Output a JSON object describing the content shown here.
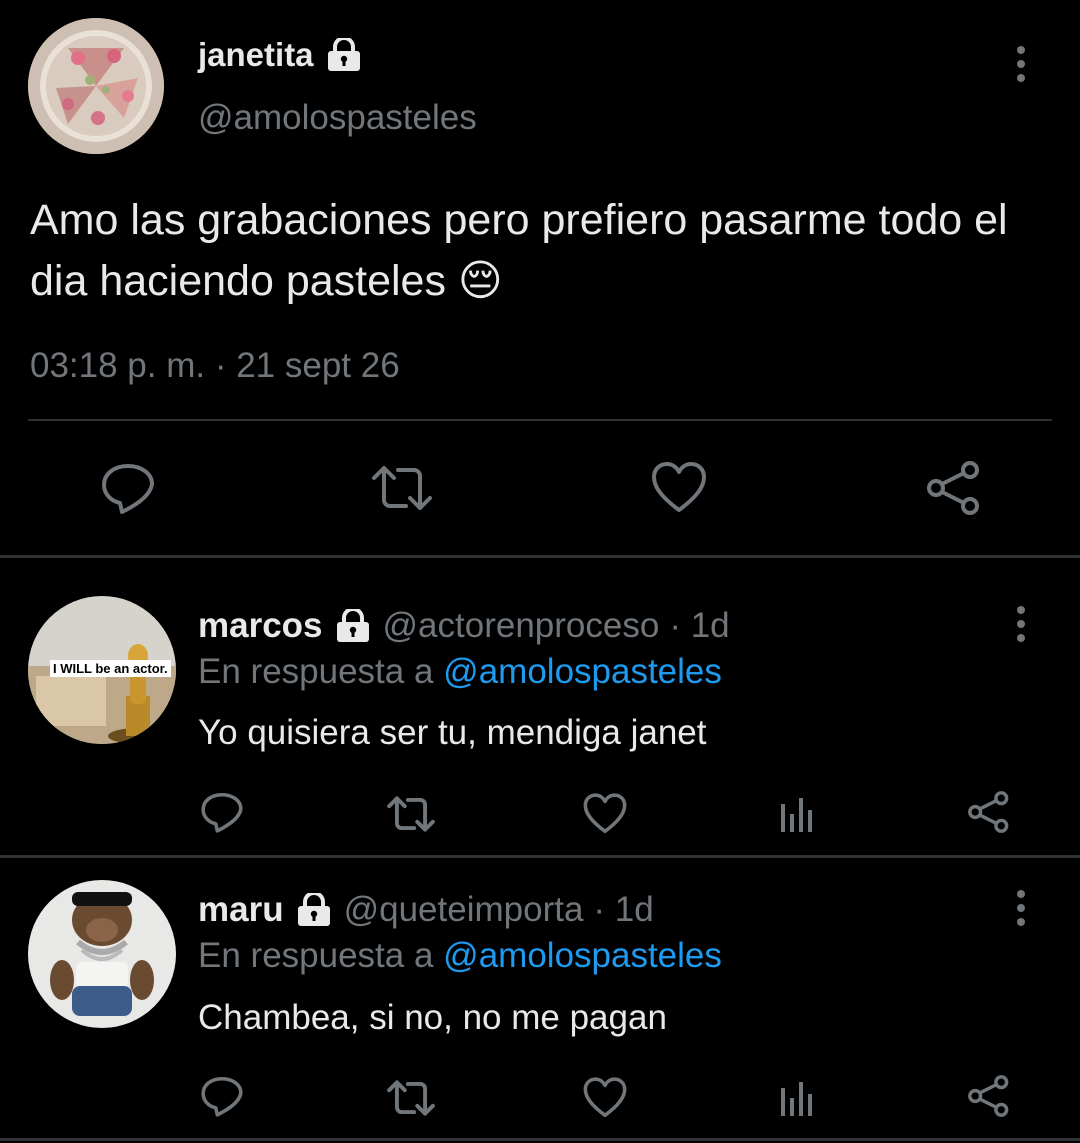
{
  "main_tweet": {
    "author_name": "janetita",
    "handle": "@amolospasteles",
    "text": "Amo las grabaciones pero prefiero pasarme todo el dia haciendo pasteles 😔",
    "timestamp": "03:18 p. m. · 21 sept 26",
    "avatar_icon": "cake-photo-avatar",
    "actions": [
      "reply-icon",
      "retweet-icon",
      "like-icon",
      "share-icon"
    ]
  },
  "replies": [
    {
      "author_name": "marcos",
      "handle": "@actorenproceso",
      "time": "· 1d",
      "reply_prefix": "En respuesta a",
      "reply_to": "@amolospasteles",
      "text": "Yo quisiera ser tu, mendiga janet",
      "avatar_caption": "I WILL be an actor.",
      "avatar_icon": "oscar-trophy-avatar"
    },
    {
      "author_name": "maru",
      "handle": "@queteimporta",
      "time": "· 1d",
      "reply_prefix": "En respuesta a",
      "reply_to": "@amolospasteles",
      "text": "Chambea, si no, no me pagan",
      "avatar_icon": "monkey-sunglasses-avatar"
    }
  ],
  "colors": {
    "background": "#000000",
    "text_primary": "#e7e9ea",
    "text_secondary": "#71767b",
    "mention_blue": "#1d9bf0",
    "divider": "#2f3336"
  }
}
